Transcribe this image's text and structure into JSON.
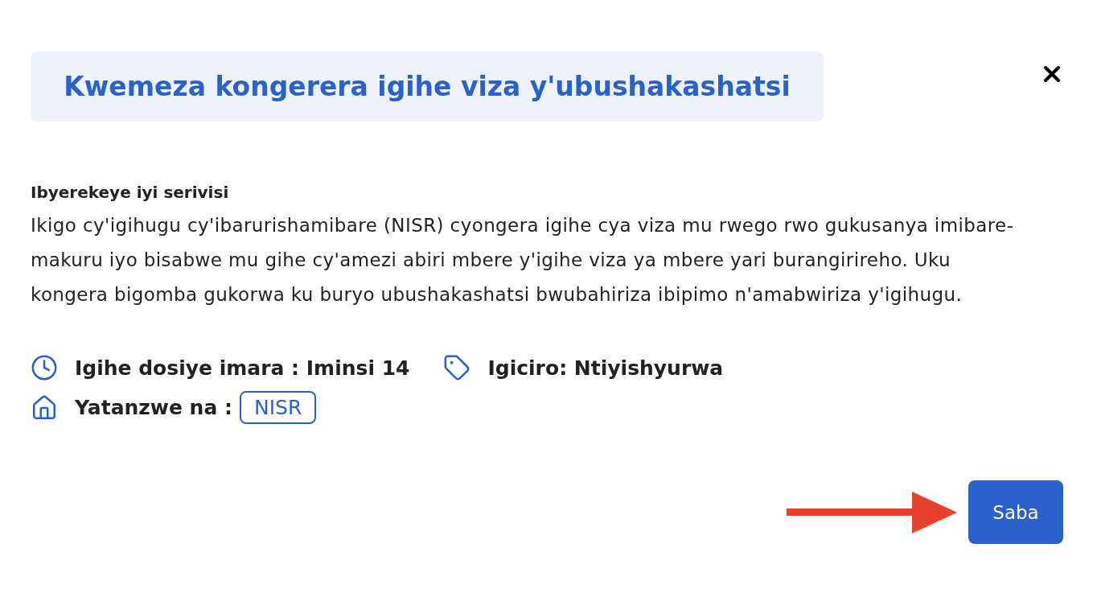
{
  "dialog": {
    "title": "Kwemeza kongerera igihe viza y'ubushakashatsi"
  },
  "about": {
    "heading": "Ibyerekeye iyi serivisi",
    "text": "Ikigo cy'igihugu cy'ibarurishamibare (NISR) cyongera igihe cya viza mu rwego rwo gukusanya imibare-makuru iyo bisabwe mu gihe cy'amezi abiri mbere y'igihe viza ya mbere yari burangirireho. Uku kongera bigomba gukorwa ku buryo ubushakashatsi bwubahiriza ibipimo n'amabwiriza y'igihugu."
  },
  "detail_rows": [
    {
      "items": [
        {
          "kind": "duration",
          "label": "Igihe dosiye imara : Iminsi 14"
        },
        {
          "kind": "price",
          "label": "Igiciro: Ntiyishyurwa"
        }
      ]
    },
    {
      "items": [
        {
          "kind": "provider",
          "label": "Yatanzwe na :",
          "badge": "NISR"
        }
      ]
    }
  ],
  "actions": [
    {
      "label": "Saba"
    }
  ]
}
